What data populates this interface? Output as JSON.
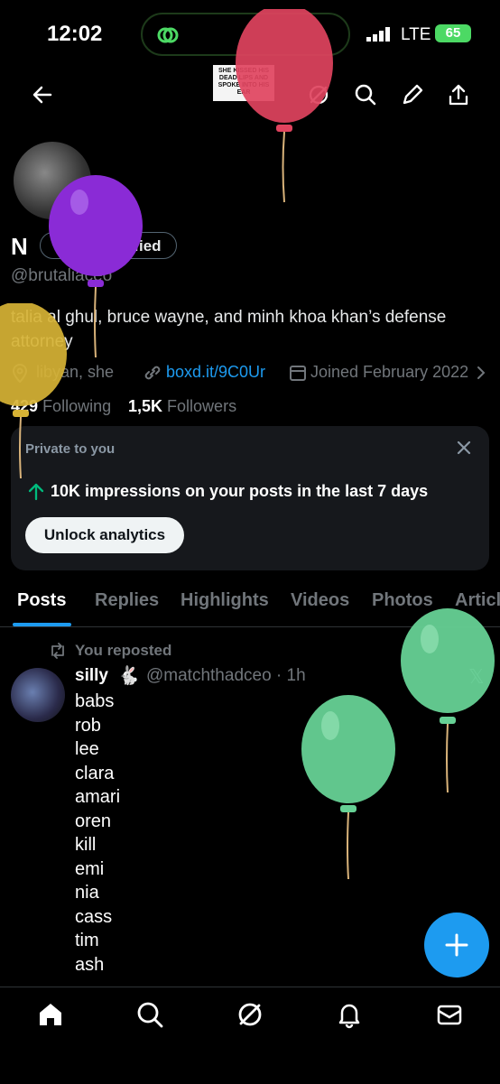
{
  "status_bar": {
    "time": "12:02",
    "network": "LTE",
    "battery": "65"
  },
  "top_bar": {
    "sticker_text": "SHE KISSED HIS DEAD LIPS AND SPOKE INTO HIS EAR"
  },
  "profile": {
    "name": "N",
    "verify_label": "Get verified",
    "handle": "@brutaliaceo",
    "bio": "talia al ghul, bruce wayne, and minh khoa khan’s defense attorney",
    "location": "libyan, she",
    "link": "boxd.it/9C0Ur",
    "joined": "Joined February 2022",
    "following_count": "429",
    "following_label": "Following",
    "followers_count": "1,5K",
    "followers_label": "Followers"
  },
  "private_card": {
    "title": "Private to you",
    "impressions": "10K impressions on your posts in the last 7 days",
    "button": "Unlock analytics"
  },
  "tabs": [
    "Posts",
    "Replies",
    "Highlights",
    "Videos",
    "Photos",
    "Articles"
  ],
  "post": {
    "repost_label": "You reposted",
    "author": "silly",
    "handle_time": "@matchthadceo · 1h",
    "lines": [
      "babs",
      "rob",
      "lee",
      "clara",
      "amari",
      "oren",
      "kill",
      "emi",
      "nia",
      "cass",
      "tim",
      "ash"
    ]
  },
  "colors": {
    "accent": "#1d9bf0",
    "background": "#000000",
    "card": "#16181c",
    "battery": "#4cd964"
  }
}
